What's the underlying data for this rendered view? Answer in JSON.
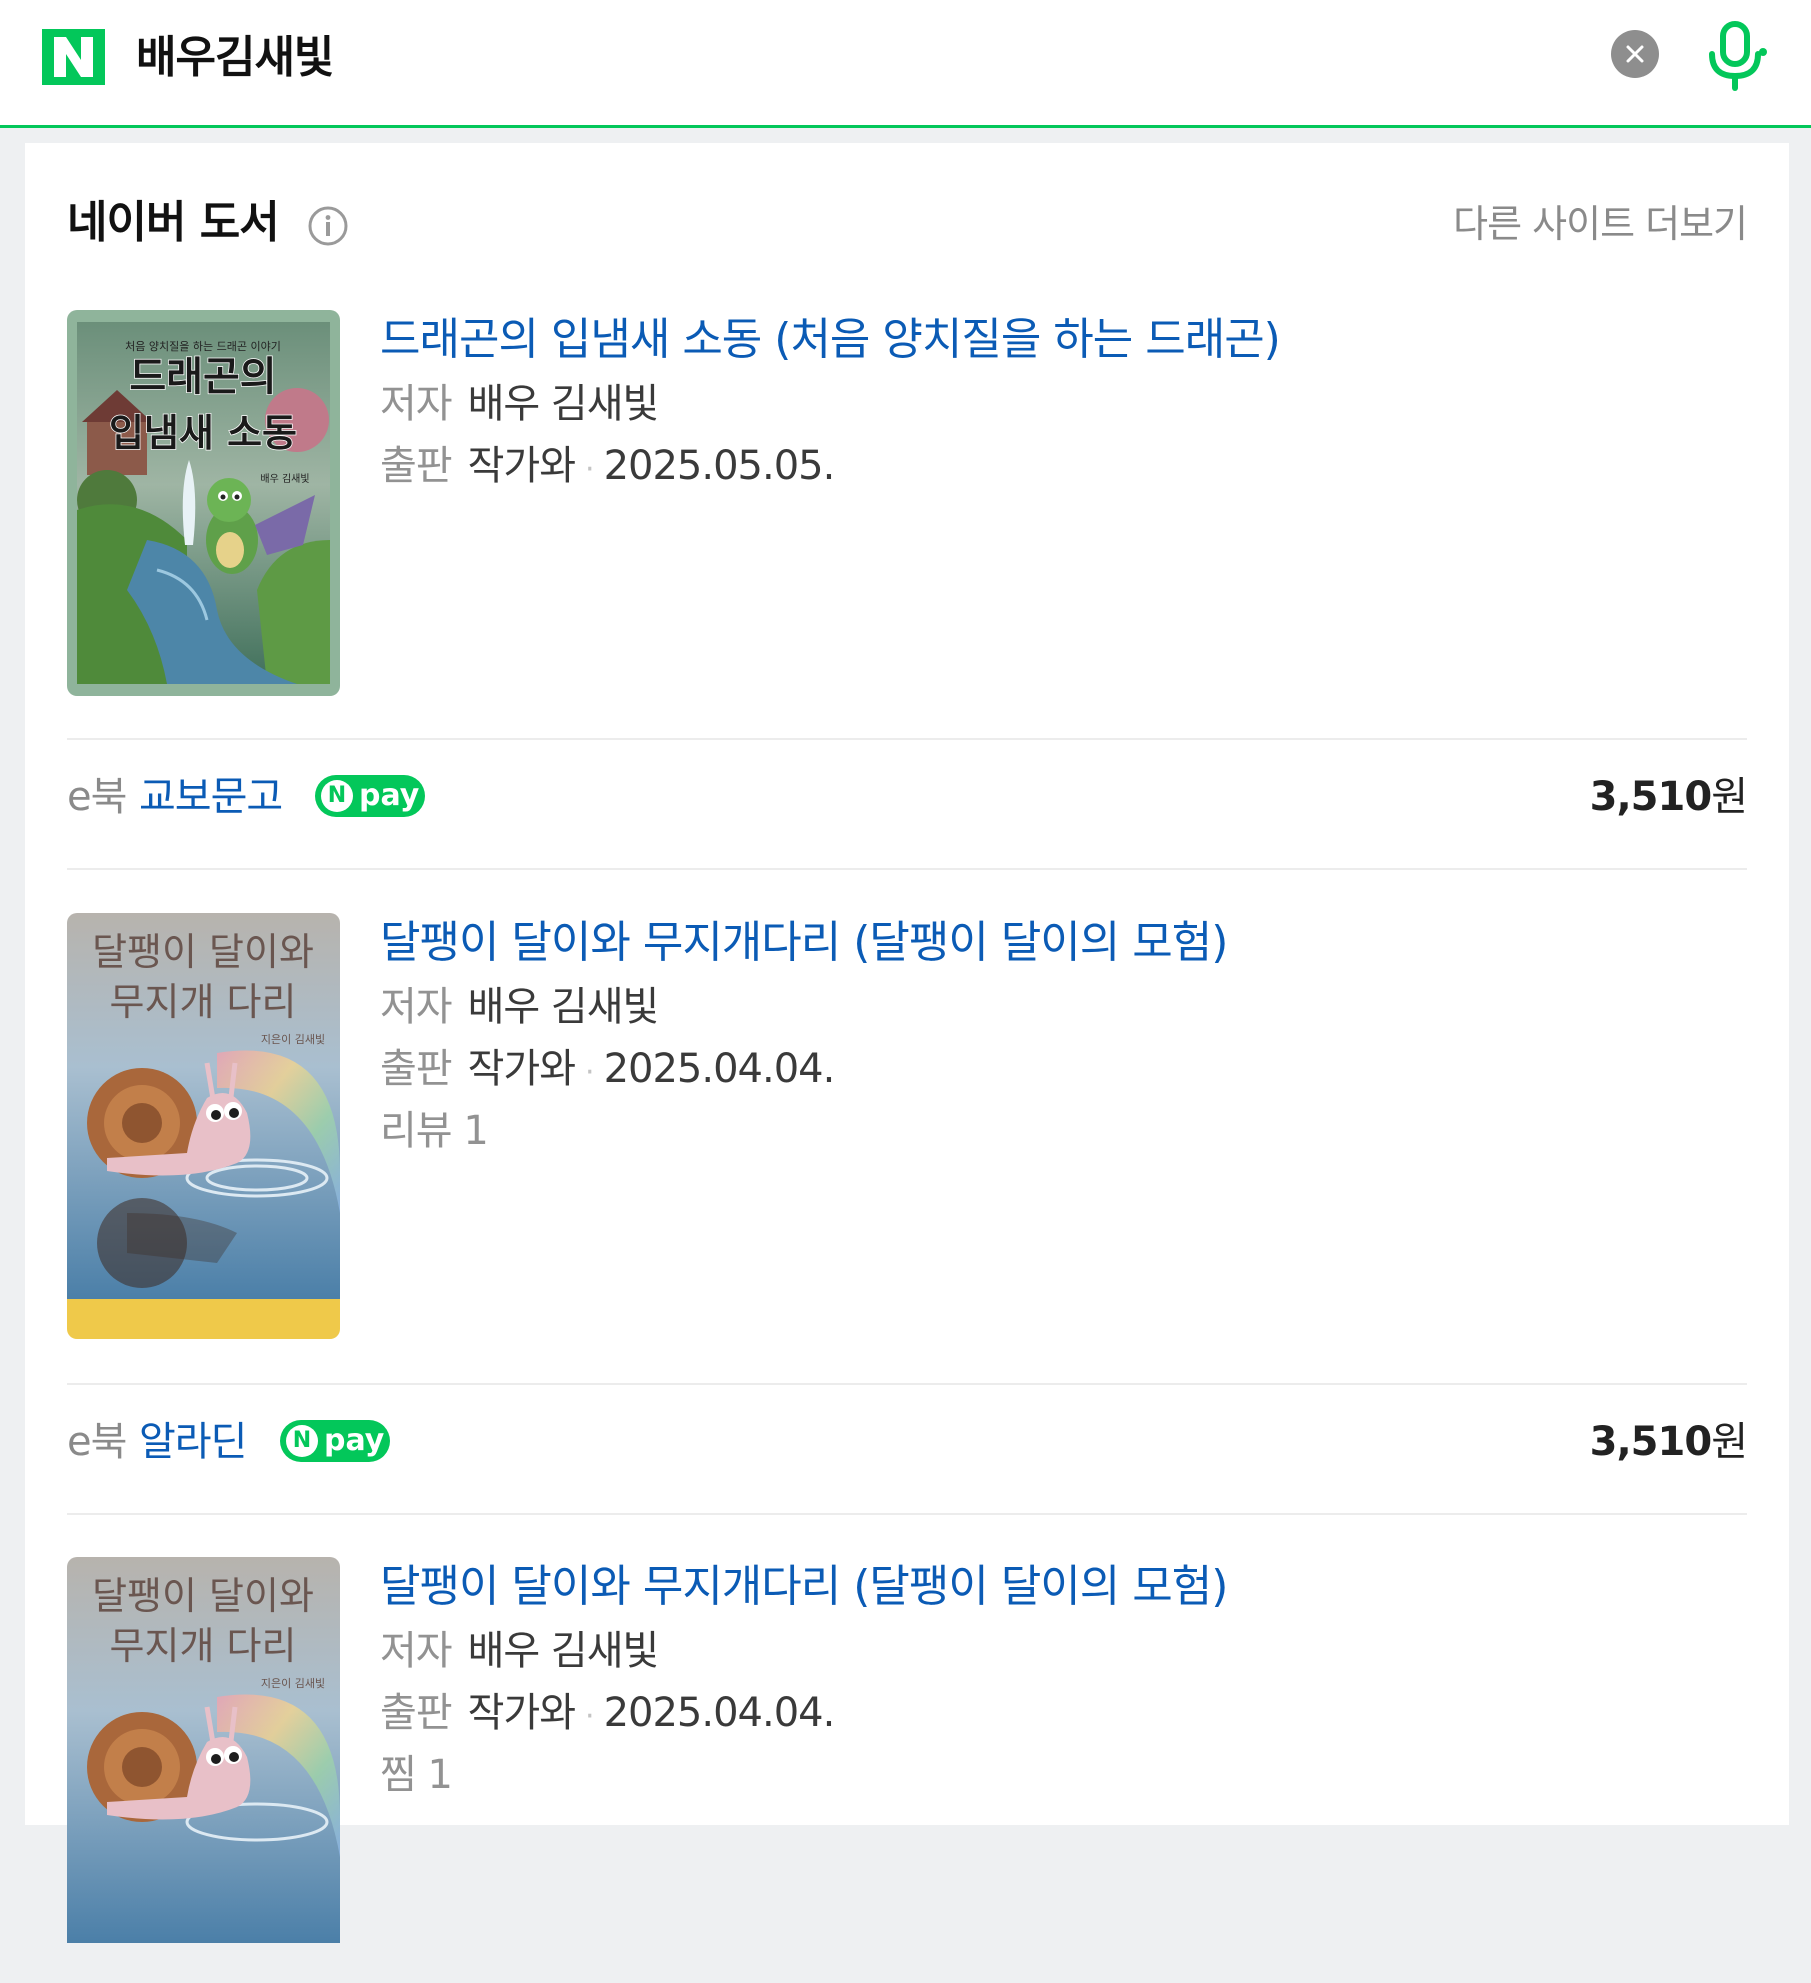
{
  "search": {
    "query": "배우김새빛"
  },
  "section": {
    "title": "네이버 도서",
    "more_link": "다른 사이트 더보기"
  },
  "labels": {
    "author": "저자",
    "publisher": "출판",
    "separator": "·"
  },
  "books": [
    {
      "title": "드래곤의 입냄새 소동 (처음 양치질을 하는 드래곤)",
      "author": "배우 김새빛",
      "publisher": "작가와",
      "date": "2025.05.05.",
      "cover": {
        "top_text": "처음 양치질을 하는 드래곤 이야기",
        "title_line1": "드래곤의",
        "title_line2": "입냄새 소동",
        "author_small": "배우 김새빛"
      },
      "store": {
        "type": "e북",
        "name": "교보문고",
        "pay": "pay",
        "price_number": "3,510",
        "price_unit": "원"
      }
    },
    {
      "title": "달팽이 달이와 무지개다리 (달팽이 달이의 모험)",
      "author": "배우 김새빛",
      "publisher": "작가와",
      "date": "2025.04.04.",
      "extra": "리뷰 1",
      "cover": {
        "title_line1": "달팽이 달이와",
        "title_line2": "무지개 다리",
        "author_small": "지은이 김새빛"
      },
      "store": {
        "type": "e북",
        "name": "알라딘",
        "pay": "pay",
        "price_number": "3,510",
        "price_unit": "원"
      }
    },
    {
      "title": "달팽이 달이와 무지개다리 (달팽이 달이의 모험)",
      "author": "배우 김새빛",
      "publisher": "작가와",
      "date": "2025.04.04.",
      "extra": "찜 1",
      "cover": {
        "title_line1": "달팽이 달이와",
        "title_line2": "무지개 다리",
        "author_small": "지은이 김새빛"
      }
    }
  ],
  "colors": {
    "brand": "#03c75a",
    "link": "#0b5bb5"
  }
}
